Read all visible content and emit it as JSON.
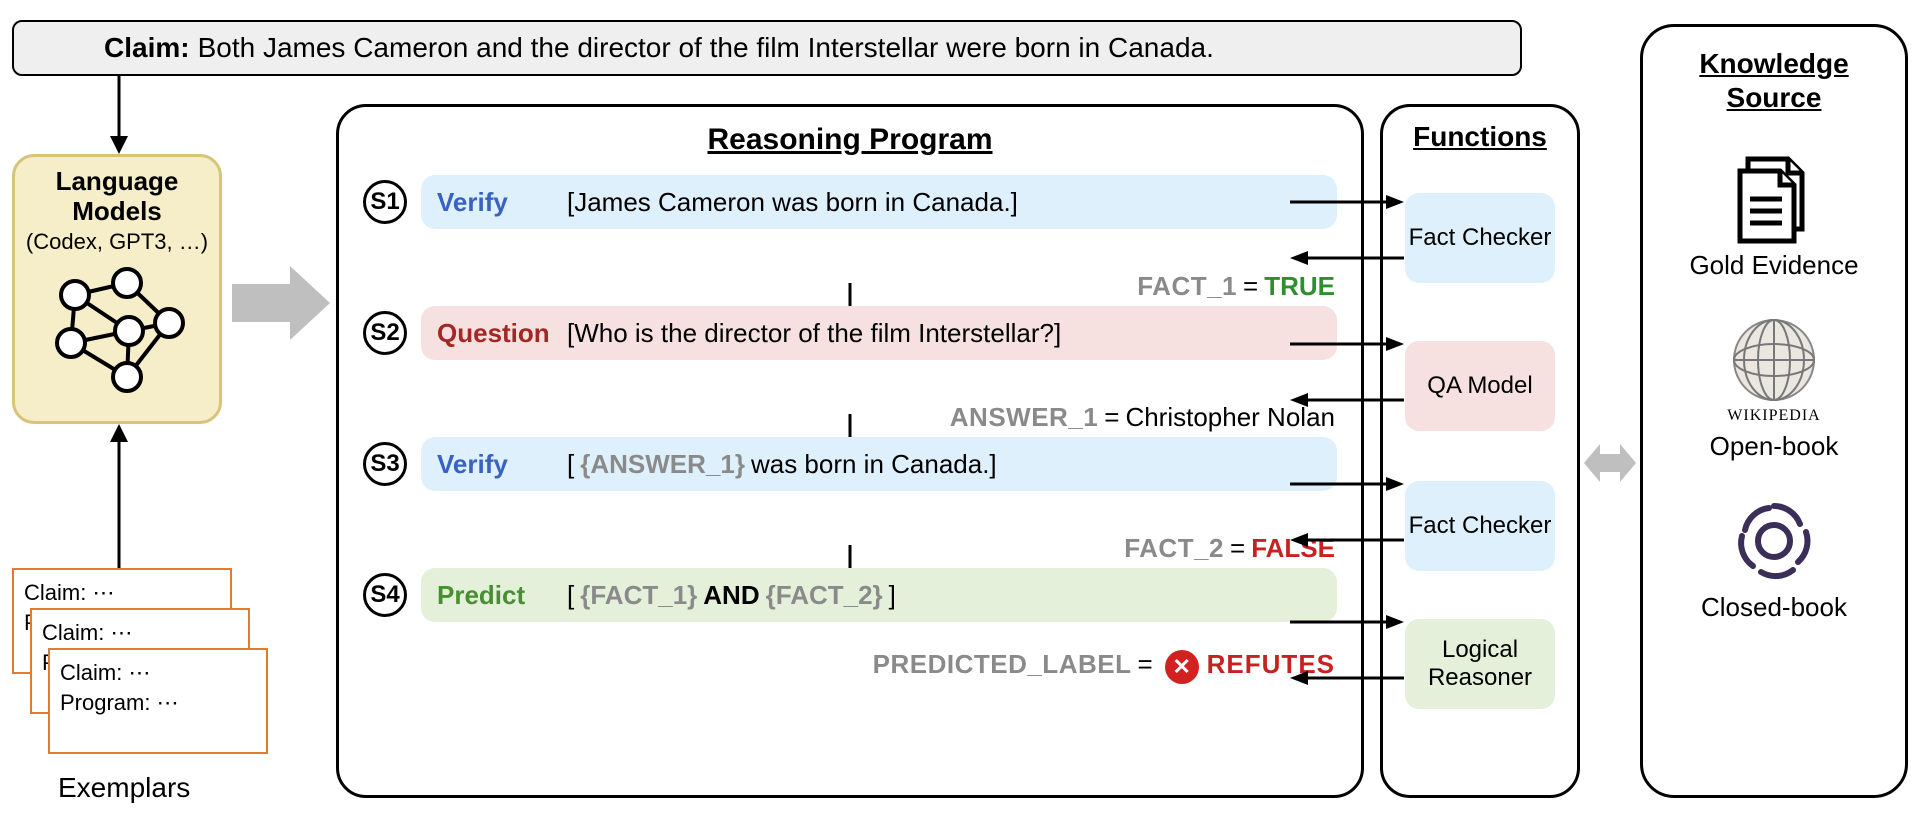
{
  "claim": {
    "label": "Claim:",
    "text": "Both James Cameron and the director of the film Interstellar were born in Canada."
  },
  "lm": {
    "title_line1": "Language",
    "title_line2": "Models",
    "subtitle": "(Codex, GPT3, …)"
  },
  "exemplars": {
    "card_claim": "Claim: ⋯",
    "card_program_short": "P",
    "card_program": "Program: ⋯",
    "label": "Exemplars"
  },
  "reasoning": {
    "title": "Reasoning Program",
    "steps": [
      {
        "id": "S1",
        "keyword": "Verify",
        "content_pre": "[James Cameron was born in Canada.]",
        "result_var": "FACT_1",
        "result_val": "TRUE",
        "result_kind": "true",
        "color": "blue"
      },
      {
        "id": "S2",
        "keyword": "Question",
        "content_pre": "[Who is the director of the film Interstellar?]",
        "result_var": "ANSWER_1",
        "result_val": "Christopher Nolan",
        "result_kind": "plain",
        "color": "red"
      },
      {
        "id": "S3",
        "keyword": "Verify",
        "content_pre_prefix": "[ ",
        "content_pre_var": "{ANSWER_1}",
        "content_pre_suffix": " was born in Canada.]",
        "result_var": "FACT_2",
        "result_val": "FALSE",
        "result_kind": "false",
        "color": "blue"
      },
      {
        "id": "S4",
        "keyword": "Predict",
        "content_pre_prefix": "[ ",
        "content_var1": "{FACT_1}",
        "content_mid": " AND ",
        "content_var2": "{FACT_2}",
        "content_suffix": "]",
        "result_var": "PREDICTED_LABEL",
        "result_val": "REFUTES",
        "result_kind": "refutes",
        "color": "green"
      }
    ]
  },
  "functions": {
    "title": "Functions",
    "items": [
      {
        "label": "Fact Checker",
        "color": "blue"
      },
      {
        "label": "QA Model",
        "color": "red"
      },
      {
        "label": "Fact Checker",
        "color": "blue"
      },
      {
        "label": "Logical Reasoner",
        "color": "green"
      }
    ]
  },
  "knowledge": {
    "title_line1": "Knowledge",
    "title_line2": "Source",
    "doc_label": "Gold Evidence",
    "wiki_word": "WIKIPEDIA",
    "wiki_label": "Open-book",
    "openai_label": "Closed-book"
  }
}
